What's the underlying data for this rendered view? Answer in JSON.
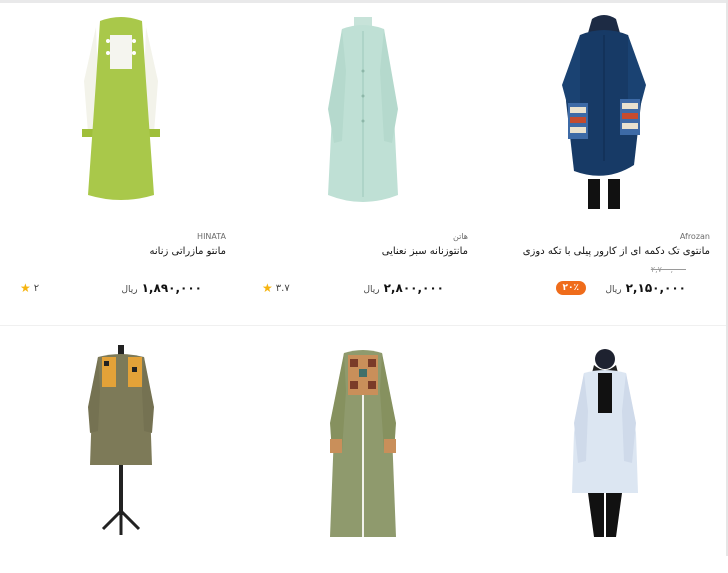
{
  "products": [
    {
      "brand": "Afrozan",
      "title": "مانتوی تک دکمه ای از کارور پیلی با تکه دوزی",
      "old_price": "۲,۷۰۰,۰۰۰",
      "price": "۲,۱۵۰,۰۰۰",
      "currency": "ریال",
      "discount": "۲۰٪",
      "rating": ""
    },
    {
      "brand": "هاتن",
      "title": "مانتوزنانه سبز نعنایی",
      "old_price": "",
      "price": "۲,۸۰۰,۰۰۰",
      "currency": "ریال",
      "discount": "",
      "rating": "۳.۷"
    },
    {
      "brand": "HINATA",
      "title": "مانتو مازراتی زنانه",
      "old_price": "",
      "price": "۱,۸۹۰,۰۰۰",
      "currency": "ریال",
      "discount": "",
      "rating": "۲"
    }
  ],
  "row2": [
    {
      "image": "white-long-coat-model"
    },
    {
      "image": "olive-coat-patterned-trim"
    },
    {
      "image": "olive-coat-on-mannequin"
    }
  ],
  "icons": {
    "rating": "star-icon"
  },
  "colors": {
    "accent": "#ef6c1b",
    "star": "#f6b40f"
  }
}
